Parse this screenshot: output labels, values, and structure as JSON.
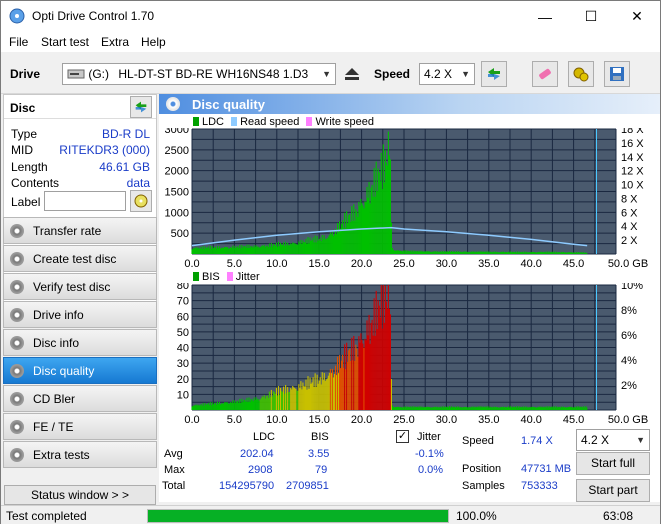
{
  "window": {
    "title": "Opti Drive Control 1.70"
  },
  "menu": {
    "items": [
      "File",
      "Start test",
      "Extra",
      "Help"
    ]
  },
  "toolbar": {
    "drive_label": "Drive",
    "drive_letter": "(G:)",
    "drive_name": "HL-DT-ST BD-RE  WH16NS48 1.D3",
    "speed_label": "Speed",
    "speed_value": "4.2 X"
  },
  "disc": {
    "header": "Disc",
    "props": [
      {
        "label": "Type",
        "value": "BD-R DL"
      },
      {
        "label": "MID",
        "value": "RITEKDR3 (000)"
      },
      {
        "label": "Length",
        "value": "46.61 GB"
      },
      {
        "label": "Contents",
        "value": "data"
      }
    ],
    "label_field": "Label",
    "label_value": ""
  },
  "nav": [
    {
      "label": "Transfer rate",
      "active": false
    },
    {
      "label": "Create test disc",
      "active": false
    },
    {
      "label": "Verify test disc",
      "active": false
    },
    {
      "label": "Drive info",
      "active": false
    },
    {
      "label": "Disc info",
      "active": false
    },
    {
      "label": "Disc quality",
      "active": true
    },
    {
      "label": "CD Bler",
      "active": false
    },
    {
      "label": "FE / TE",
      "active": false
    },
    {
      "label": "Extra tests",
      "active": false
    }
  ],
  "status_window_label": "Status window > >",
  "panel": {
    "title": "Disc quality"
  },
  "legend_top": [
    "LDC",
    "Read speed",
    "Write speed"
  ],
  "legend_bottom": [
    "BIS",
    "Jitter"
  ],
  "colors": {
    "ldc": "#00c000",
    "read": "#8ecbff",
    "write": "#ff80ff",
    "bis": "#00c000",
    "jitter": "#ff80ff",
    "plot_bg": "#4a5a6e",
    "grid": "#1a2840",
    "accent": "#1a3cc8"
  },
  "stats": {
    "cols": [
      "LDC",
      "BIS"
    ],
    "rows": [
      {
        "label": "Avg",
        "ldc": "202.04",
        "bis": "3.55",
        "jitter": "-0.1%"
      },
      {
        "label": "Max",
        "ldc": "2908",
        "bis": "79",
        "jitter": "0.0%"
      },
      {
        "label": "Total",
        "ldc": "154295790",
        "bis": "2709851"
      }
    ],
    "jitter_label": "Jitter",
    "jitter_checked": true,
    "speed_label": "Speed",
    "speed_value": "1.74 X",
    "position_label": "Position",
    "position_value": "47731 MB",
    "samples_label": "Samples",
    "samples_value": "753333",
    "speed_select": "4.2 X",
    "start_full": "Start full",
    "start_part": "Start part"
  },
  "status": {
    "text": "Test completed",
    "progress": 100.0,
    "progress_label": "100.0%",
    "time": "63:08"
  },
  "chart_data": [
    {
      "type": "bar",
      "title": "",
      "series": [
        {
          "name": "LDC",
          "x": [
            0,
            2,
            4,
            6,
            8,
            10,
            12,
            14,
            15,
            16,
            17,
            18,
            19,
            20,
            21,
            22,
            22.5,
            23,
            23.3,
            23.6,
            24,
            26,
            28,
            30,
            32,
            34,
            36,
            38,
            40,
            42,
            44,
            46,
            46.6
          ],
          "values": [
            150,
            160,
            170,
            180,
            200,
            230,
            270,
            340,
            380,
            450,
            600,
            800,
            1000,
            1300,
            1600,
            1900,
            2100,
            2400,
            2908,
            150,
            90,
            70,
            65,
            60,
            60,
            55,
            55,
            50,
            50,
            50,
            45,
            40,
            30
          ]
        },
        {
          "name": "Read speed",
          "x": [
            0,
            5,
            10,
            15,
            20,
            23.5,
            25,
            30,
            35,
            40,
            45,
            46.6
          ],
          "values": [
            1.2,
            2.0,
            2.7,
            3.2,
            3.6,
            3.8,
            3.6,
            3.2,
            2.7,
            2.1,
            1.4,
            1.2
          ]
        }
      ],
      "xlim": [
        0,
        50
      ],
      "ylim": [
        0,
        3000
      ],
      "x_ticks": [
        "0.0",
        "5.0",
        "10.0",
        "15.0",
        "20.0",
        "25.0",
        "30.0",
        "35.0",
        "40.0",
        "45.0",
        "50.0 GB"
      ],
      "y_ticks": [
        "500",
        "1000",
        "1500",
        "2000",
        "2500",
        "3000"
      ],
      "y2_ticks": [
        "2 X",
        "4 X",
        "6 X",
        "8 X",
        "10 X",
        "12 X",
        "14 X",
        "16 X",
        "18 X"
      ],
      "y2lim": [
        0,
        18
      ],
      "marker_x": 47.7
    },
    {
      "type": "bar",
      "title": "",
      "series": [
        {
          "name": "BIS",
          "x": [
            0,
            2,
            4,
            6,
            8,
            10,
            12,
            14,
            15,
            16,
            17,
            18,
            19,
            20,
            21,
            22,
            22.5,
            23,
            23.3,
            23.6,
            24,
            26,
            28,
            30,
            32,
            34,
            36,
            38,
            40,
            42,
            44,
            46,
            46.6
          ],
          "values": [
            3,
            4,
            5,
            6,
            8,
            12,
            15,
            18,
            20,
            24,
            28,
            34,
            40,
            48,
            56,
            65,
            70,
            75,
            79,
            3,
            2,
            2,
            2,
            2,
            2,
            2,
            2,
            2,
            2,
            2,
            2,
            2,
            2
          ]
        }
      ],
      "xlim": [
        0,
        50
      ],
      "ylim": [
        0,
        80
      ],
      "x_ticks": [
        "0.0",
        "5.0",
        "10.0",
        "15.0",
        "20.0",
        "25.0",
        "30.0",
        "35.0",
        "40.0",
        "45.0",
        "50.0 GB"
      ],
      "y_ticks": [
        "10",
        "20",
        "30",
        "40",
        "50",
        "60",
        "70",
        "80"
      ],
      "y2_ticks": [
        "2%",
        "4%",
        "6%",
        "8%",
        "10%"
      ],
      "y2lim": [
        0,
        10
      ],
      "marker_x": 47.7
    }
  ]
}
